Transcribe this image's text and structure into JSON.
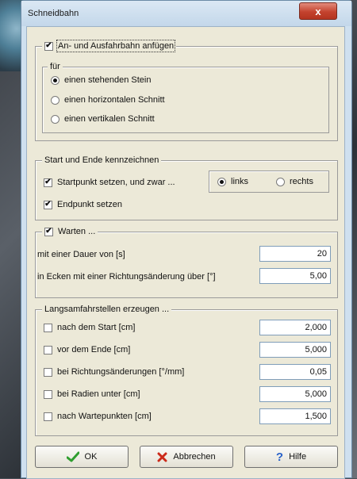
{
  "window": {
    "title": "Schneidbahn",
    "close_label": "x"
  },
  "group_approach": {
    "checkbox_label": "An- und Ausfahrbahn anfügen",
    "checked": true,
    "sub_label": "für",
    "options": [
      {
        "label": "einen stehenden Stein",
        "selected": true
      },
      {
        "label": "einen horizontalen Schnitt",
        "selected": false
      },
      {
        "label": "einen vertikalen Schnitt",
        "selected": false
      }
    ]
  },
  "group_start_end": {
    "label": "Start und Ende kennzeichnen",
    "startpoint_label": "Startpunkt setzen, und zwar ...",
    "startpoint_checked": true,
    "direction_options": [
      {
        "label": "links",
        "selected": true
      },
      {
        "label": "rechts",
        "selected": false
      }
    ],
    "endpoint_label": "Endpunkt setzen",
    "endpoint_checked": true
  },
  "group_wait": {
    "checkbox_label": "Warten ...",
    "checked": true,
    "duration_label": "mit einer Dauer von [s]",
    "duration_value": "20",
    "corner_label": "in Ecken mit einer Richtungsänderung über [°]",
    "corner_value": "5,00"
  },
  "group_slow": {
    "label": "Langsamfahrstellen erzeugen ...",
    "items": [
      {
        "label": "nach dem Start [cm]",
        "checked": false,
        "value": "2,000"
      },
      {
        "label": "vor dem Ende [cm]",
        "checked": false,
        "value": "5,000"
      },
      {
        "label": "bei Richtungsänderungen [°/mm]",
        "checked": false,
        "value": "0,05"
      },
      {
        "label": "bei Radien unter [cm]",
        "checked": false,
        "value": "5,000"
      },
      {
        "label": "nach Wartepunkten [cm]",
        "checked": false,
        "value": "1,500"
      }
    ]
  },
  "buttons": {
    "ok": "OK",
    "cancel": "Abbrechen",
    "help": "Hilfe"
  },
  "colors": {
    "ok_icon": "#2f9e2f",
    "cancel_icon": "#cc2a1a",
    "help_icon": "#2a62c9",
    "close_button": "#c4432e"
  }
}
